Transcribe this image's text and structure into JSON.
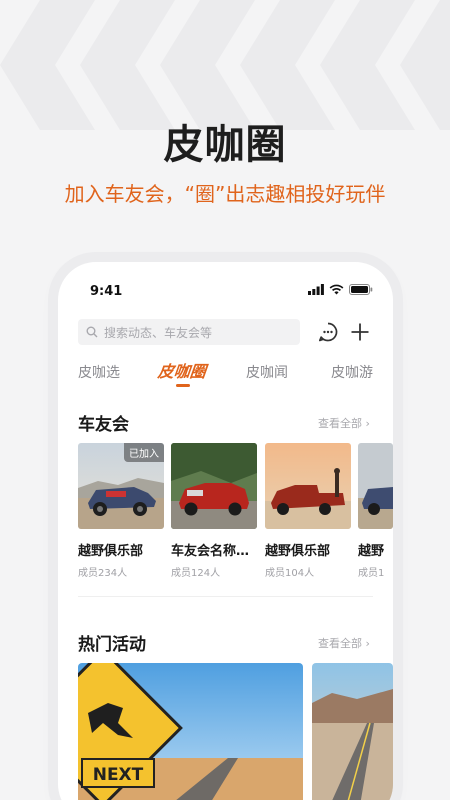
{
  "hero": {
    "title": "皮咖圈",
    "subtitle": "加入车友会，“圈”出志趣相投好玩伴"
  },
  "colors": {
    "accent": "#e0641c",
    "muted": "#a8a8ad"
  },
  "status_bar": {
    "time": "9:41"
  },
  "search": {
    "placeholder": "搜索动态、车友会等"
  },
  "tabs": [
    {
      "label": "皮咖选",
      "active": false
    },
    {
      "label": "皮咖圈",
      "active": true
    },
    {
      "label": "皮咖闻",
      "active": false
    },
    {
      "label": "皮咖游",
      "active": false
    }
  ],
  "clubs_section": {
    "title": "车友会",
    "see_all": "查看全部 ›",
    "items": [
      {
        "name": "越野俱乐部",
        "members": "成员234人",
        "badge": "已加入"
      },
      {
        "name": "车友会名称…",
        "members": "成员124人"
      },
      {
        "name": "越野俱乐部",
        "members": "成员104人"
      },
      {
        "name": "越野",
        "members": "成员1"
      }
    ]
  },
  "events_section": {
    "title": "热门活动",
    "see_all": "查看全部 ›",
    "sign_text": "NEXT"
  }
}
